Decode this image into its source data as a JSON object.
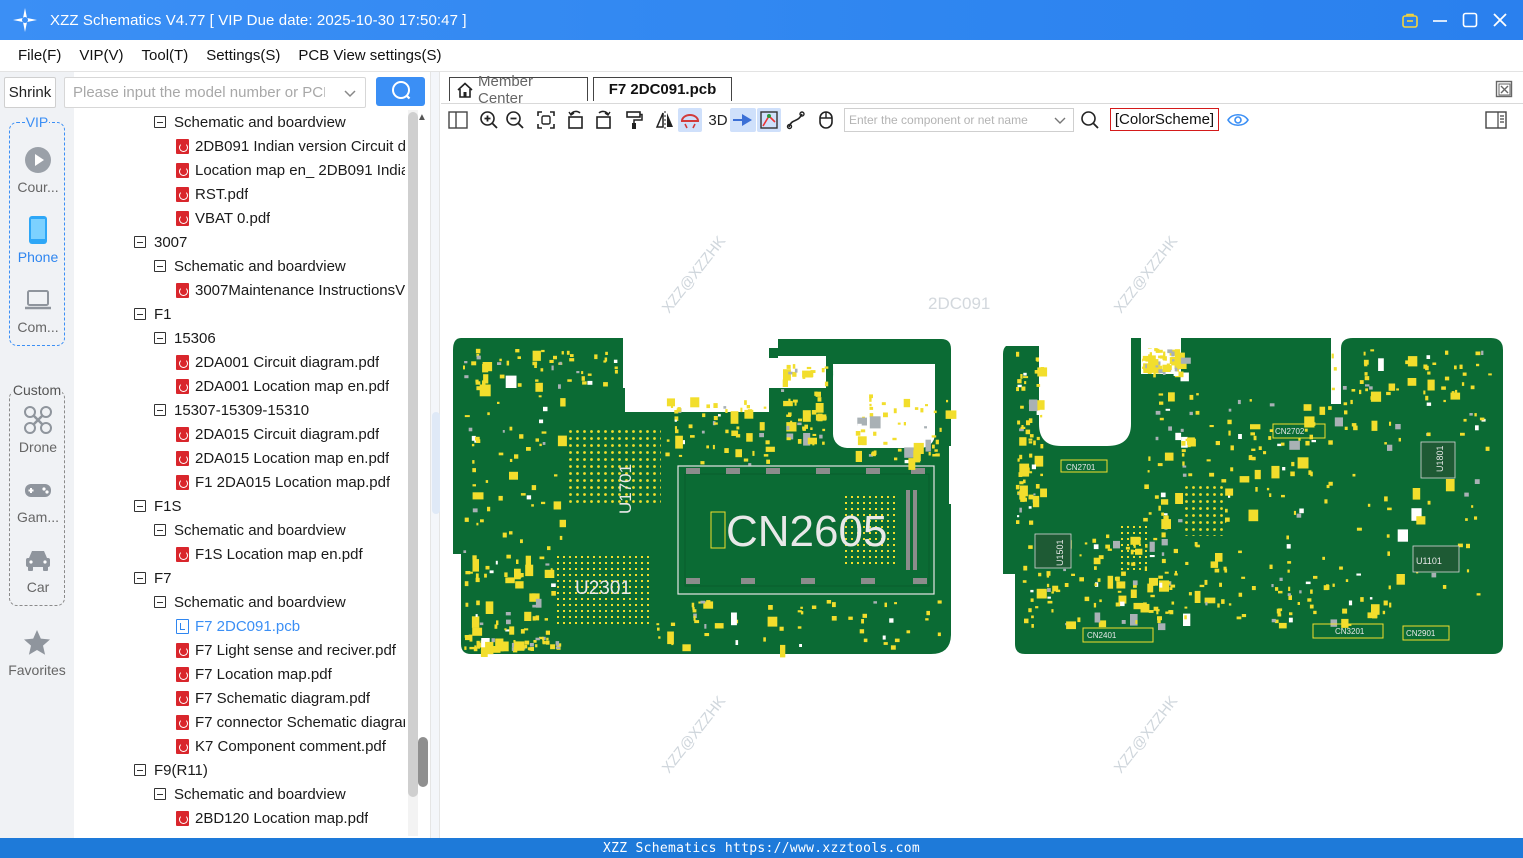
{
  "window": {
    "title": "XZZ Schematics V4.77 [ VIP Due date: 2025-10-30 17:50:47 ]"
  },
  "menu": [
    "File(F)",
    "VIP(V)",
    "Tool(T)",
    "Settings(S)",
    "PCB View settings(S)"
  ],
  "leftnav": {
    "shrink_label": "Shrink",
    "vip_label": "VIP",
    "custom_label": "Custom",
    "vip_items": [
      "Cour...",
      "Phone",
      "Com..."
    ],
    "custom_items": [
      "Drone",
      "Gam...",
      "Car"
    ],
    "favorites_label": "Favorites"
  },
  "search": {
    "placeholder": "Please input the model number or PCB"
  },
  "tree": [
    {
      "level": 1,
      "kind": "folder",
      "label": "Schematic and boardview"
    },
    {
      "level": 2,
      "kind": "pdf",
      "label": "2DB091 Indian version Circuit d"
    },
    {
      "level": 2,
      "kind": "pdf",
      "label": "Location map en_ 2DB091 India"
    },
    {
      "level": 2,
      "kind": "pdf",
      "label": "RST.pdf"
    },
    {
      "level": 2,
      "kind": "pdf",
      "label": "VBAT 0.pdf"
    },
    {
      "level": 0,
      "kind": "folder",
      "label": "3007"
    },
    {
      "level": 1,
      "kind": "folder",
      "label": "Schematic and boardview"
    },
    {
      "level": 2,
      "kind": "pdf",
      "label": "3007Maintenance InstructionsV"
    },
    {
      "level": 0,
      "kind": "folder",
      "label": "F1"
    },
    {
      "level": 1,
      "kind": "folder",
      "label": "15306"
    },
    {
      "level": 2,
      "kind": "pdf",
      "label": "2DA001 Circuit diagram.pdf"
    },
    {
      "level": 2,
      "kind": "pdf",
      "label": "2DA001 Location map en.pdf"
    },
    {
      "level": 1,
      "kind": "folder",
      "label": "15307-15309-15310"
    },
    {
      "level": 2,
      "kind": "pdf",
      "label": "2DA015 Circuit diagram.pdf"
    },
    {
      "level": 2,
      "kind": "pdf",
      "label": "2DA015 Location map en.pdf"
    },
    {
      "level": 2,
      "kind": "pdf",
      "label": "F1 2DA015 Location map.pdf"
    },
    {
      "level": 0,
      "kind": "folder",
      "label": "F1S"
    },
    {
      "level": 1,
      "kind": "folder",
      "label": "Schematic and boardview"
    },
    {
      "level": 2,
      "kind": "pdf",
      "label": "F1S Location map en.pdf"
    },
    {
      "level": 0,
      "kind": "folder",
      "label": "F7"
    },
    {
      "level": 1,
      "kind": "folder",
      "label": "Schematic and boardview"
    },
    {
      "level": 2,
      "kind": "pcb",
      "label": "F7 2DC091.pcb",
      "selected": true
    },
    {
      "level": 2,
      "kind": "pdf",
      "label": "F7 Light sense and reciver.pdf"
    },
    {
      "level": 2,
      "kind": "pdf",
      "label": "F7 Location map.pdf"
    },
    {
      "level": 2,
      "kind": "pdf",
      "label": "F7 Schematic diagram.pdf"
    },
    {
      "level": 2,
      "kind": "pdf",
      "label": "F7 connector Schematic diagrar"
    },
    {
      "level": 2,
      "kind": "pdf",
      "label": "K7 Component comment.pdf"
    },
    {
      "level": 0,
      "kind": "folder",
      "label": "F9(R11)"
    },
    {
      "level": 1,
      "kind": "folder",
      "label": "Schematic and boardview"
    },
    {
      "level": 2,
      "kind": "pdf",
      "label": "2BD120 Location map.pdf"
    }
  ],
  "tabs": {
    "member_center": "Member Center",
    "active_file": "F7 2DC091.pcb"
  },
  "toolbar": {
    "label_3d": "3D",
    "component_placeholder": "Enter the component or net name",
    "color_scheme": "[ColorScheme]"
  },
  "board": {
    "board_name": "2DC091",
    "watermark": "XZZ@XZZHK",
    "big_label": "CN2605",
    "labels_left": [
      "U1701",
      "U2301"
    ],
    "labels_right": [
      "CN2701",
      "CN2702",
      "U1801",
      "U1101",
      "U1501",
      "CN2401",
      "CN3201",
      "CN2901"
    ]
  },
  "statusbar": {
    "text": "XZZ Schematics https://www.xzztools.com"
  },
  "colors": {
    "accent": "#3b8ff5",
    "pcb_green": "#0b6b34",
    "pad_yellow": "#f2de2c",
    "statusbar": "#1e7ad9"
  }
}
